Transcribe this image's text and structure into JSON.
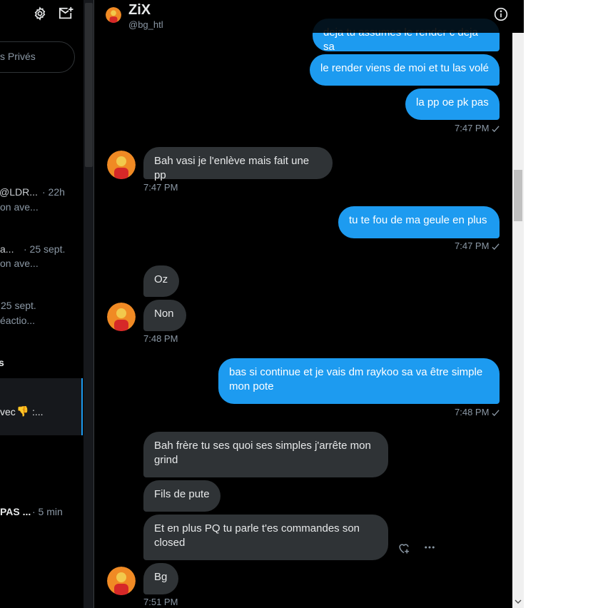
{
  "left_panel": {
    "search_placeholder": "s Privés",
    "rows": [
      {
        "line1": "@LDR...",
        "time": "· 22h",
        "line2": "on ave..."
      },
      {
        "line1": "a...",
        "time": "· 25 sept.",
        "line2": "on ave..."
      },
      {
        "line1": "25 sept.",
        "line2": "éactio..."
      }
    ],
    "fragment": "s",
    "selected_snippet": "vec",
    "selected_emoji": "👎",
    "selected_suffix": ":...",
    "last_row_name": "PAS ...",
    "last_row_time": "· 5 min"
  },
  "header": {
    "name": "ZiX",
    "handle": "@bg_htl"
  },
  "messages": {
    "m1": "deja tu assumes le render c deja sa",
    "m2": "le render viens de moi et tu las volé",
    "m3": "la pp oe pk pas",
    "t1": "7:47 PM",
    "m4": "Bah vasi je l'enlève mais fait une pp",
    "t2": "7:47 PM",
    "m5": "tu te fou de ma geule en plus",
    "t3": "7:47 PM",
    "m6": "Oz",
    "m7": "Non",
    "t4": "7:48 PM",
    "m8": "bas si continue et je vais dm raykoo sa va être simple mon pote",
    "t5": "7:48 PM",
    "m9": "Bah frère tu ses quoi ses simples j'arrête mon grind",
    "m10": "Fils de pute",
    "m11": "Et en plus PQ tu parle t'es commandes son closed",
    "m12": "Bg",
    "t6": "7:51 PM"
  },
  "colors": {
    "sent_bubble": "#1d9bf0",
    "received_bubble": "#2f3336",
    "background": "#000000",
    "muted_text": "#8b98a5"
  },
  "icons": [
    "gear-icon",
    "new-message-icon",
    "info-icon",
    "like-add-icon",
    "more-icon",
    "check-icon"
  ]
}
